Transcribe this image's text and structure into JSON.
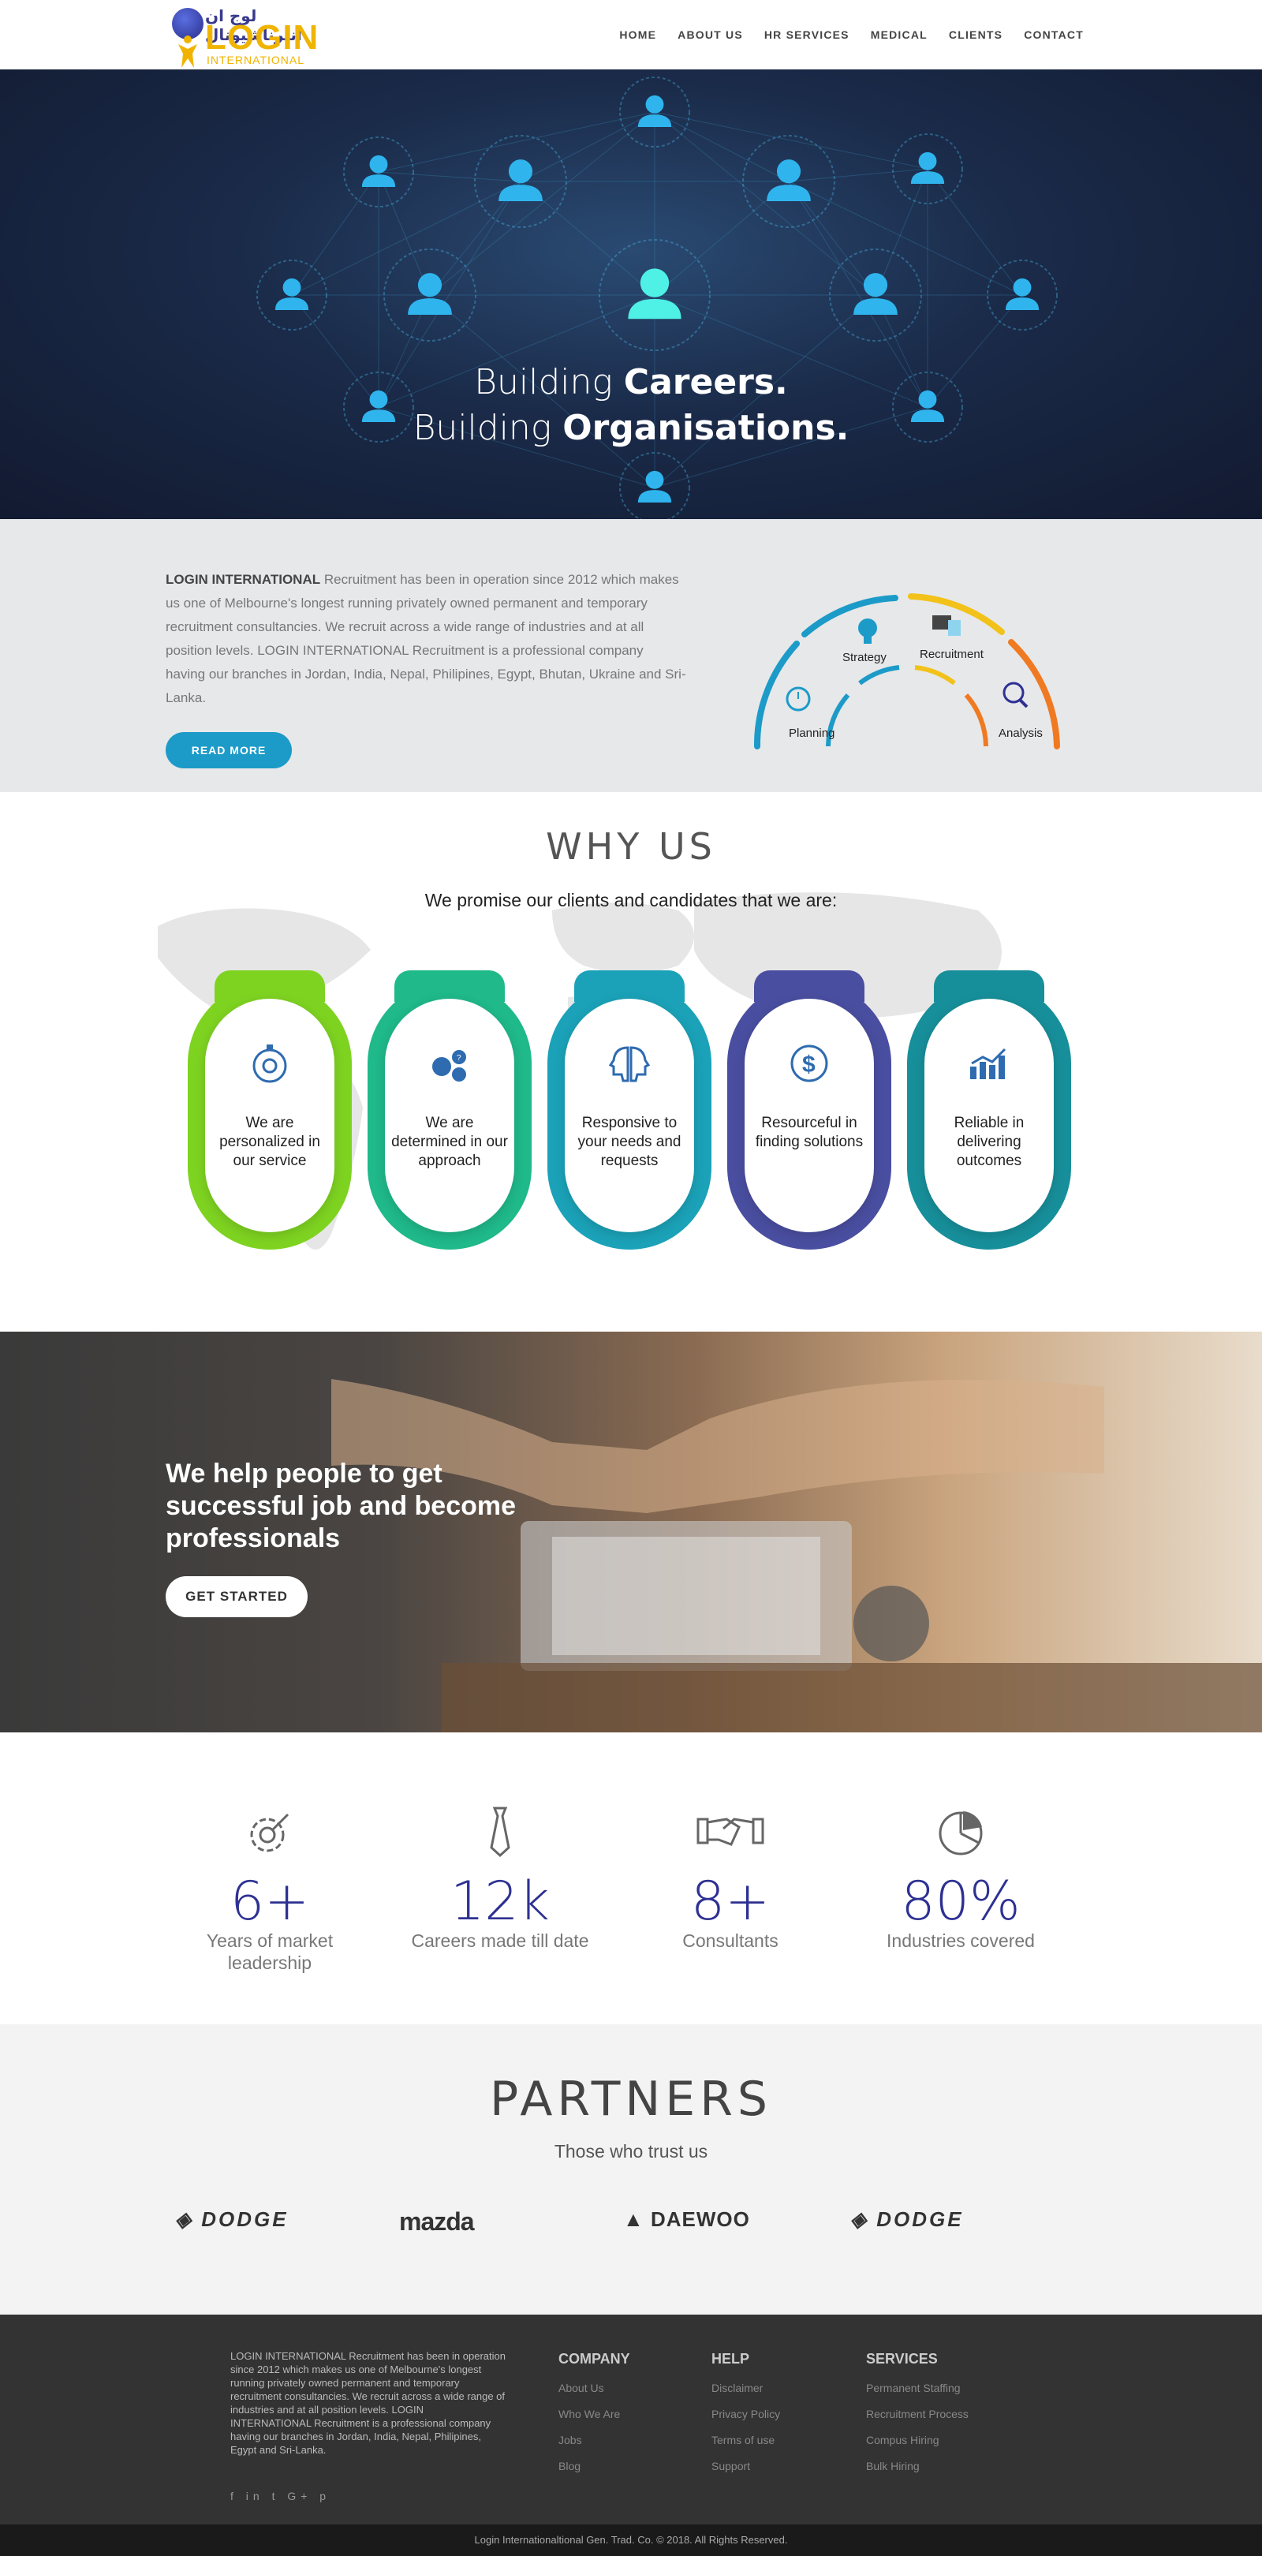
{
  "brand": {
    "arabic": "لوج ان انترناشيونال",
    "name": "LOGIN",
    "sub": "INTERNATIONAL"
  },
  "nav": [
    "HOME",
    "ABOUT US",
    "HR SERVICES",
    "MEDICAL",
    "CLIENTS",
    "CONTACT"
  ],
  "hero": {
    "line1_light": "Building ",
    "line1_bold": "Careers.",
    "line2_light": "Building ",
    "line2_bold": "Organisations."
  },
  "about": {
    "lead": "LOGIN INTERNATIONAL",
    "text": " Recruitment has been in operation since 2012 which makes us one of Melbourne's longest running privately owned permanent and temporary recruitment consultancies. We recruit across a wide range of industries and at all position levels. LOGIN INTERNATIONAL Recruitment is a professional company having our branches in Jordan, India, Nepal, Philipines, Egypt, Bhutan, Ukraine and Sri-Lanka.",
    "button": "READ MORE",
    "process": [
      "Planning",
      "Strategy",
      "Recruitment",
      "Analysis"
    ],
    "colors": {
      "blue": "#1c9bc8",
      "yellow": "#f2c21a",
      "orange": "#ef7a22"
    }
  },
  "why": {
    "title": "WHY US",
    "lead": "We promise our clients and candidates that we are:",
    "cards": [
      {
        "text": "We are personalized in our service",
        "icon": "stopwatch-gear-icon",
        "color": "#7ed321"
      },
      {
        "text": "We are determined in our approach",
        "icon": "question-heads-icon",
        "color": "#1fb98a"
      },
      {
        "text": "Responsive to your needs and requests",
        "icon": "two-heads-icon",
        "color": "#1ba2b8"
      },
      {
        "text": "Resourceful in finding solutions",
        "icon": "dollar-cycle-icon",
        "color": "#4a4ea0"
      },
      {
        "text": "Reliable in delivering outcomes",
        "icon": "bar-chart-icon",
        "color": "#178f9a"
      }
    ]
  },
  "cta": {
    "title": "We help people to get successful job and become professionals",
    "button": "GET STARTED"
  },
  "stats": [
    {
      "num": "6+",
      "label": "Years of market leadership",
      "icon": "gear-target-icon"
    },
    {
      "num": "12k",
      "label": "Careers made till date",
      "icon": "tie-icon"
    },
    {
      "num": "8+",
      "label": "Consultants",
      "icon": "handshake-icon"
    },
    {
      "num": "80%",
      "label": "Industries covered",
      "icon": "pie-chart-icon"
    }
  ],
  "partners": {
    "title": "PARTNERS",
    "sub": "Those who trust us",
    "logos": [
      "DODGE",
      "mazda",
      "DAEWOO",
      "DODGE"
    ]
  },
  "footer": {
    "text": "LOGIN INTERNATIONAL Recruitment has been in operation since 2012 which makes us one of Melbourne's longest running privately owned permanent and temporary recruitment consultancies. We recruit across a wide range of industries and at all position levels. LOGIN INTERNATIONAL Recruitment is a professional company having our branches in Jordan, India, Nepal, Philipines, Egypt and Sri-Lanka.",
    "company": {
      "title": "COMPANY",
      "links": [
        "About Us",
        "Who We Are",
        "Jobs",
        "Blog"
      ]
    },
    "help": {
      "title": "HELP",
      "links": [
        "Disclaimer",
        "Privacy Policy",
        "Terms of use",
        "Support"
      ]
    },
    "services": {
      "title": "SERVICES",
      "links": [
        "Permanent Staffing",
        "Recruitment Process",
        "Compus Hiring",
        "Bulk Hiring"
      ]
    },
    "social": "f  in  t  G+  p",
    "copyright": "Login Internationaltional Gen. Trad. Co. © 2018. All Rights Reserved."
  }
}
